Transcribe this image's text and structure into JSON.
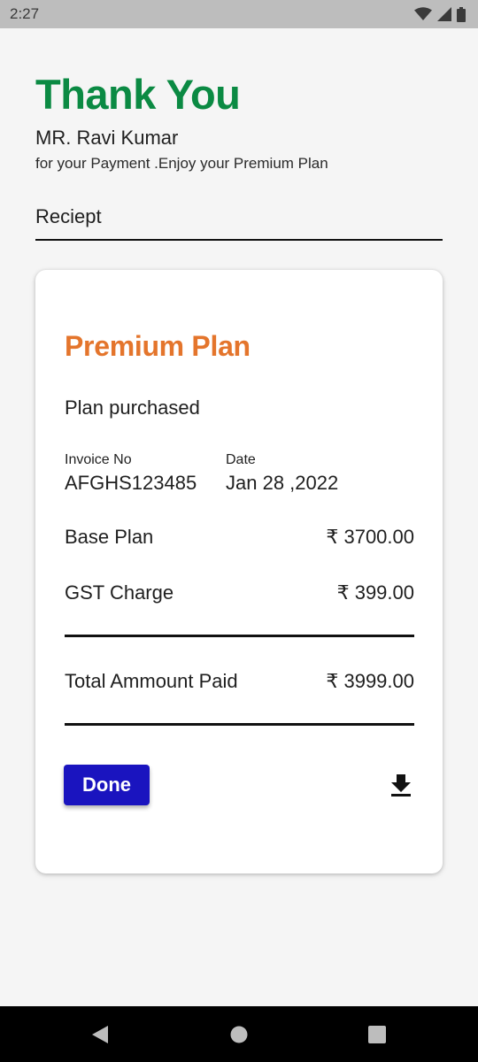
{
  "status_bar": {
    "time": "2:27",
    "icons": [
      "wifi-icon",
      "signal-icon",
      "battery-icon"
    ]
  },
  "header": {
    "title": "Thank You",
    "name": "MR. Ravi Kumar",
    "subtitle": "for your Payment .Enjoy your Premium Plan",
    "receipt_label": "Reciept"
  },
  "card": {
    "plan_title": "Premium Plan",
    "plan_sub": "Plan purchased",
    "invoice_label": "Invoice No",
    "invoice_value": "AFGHS123485",
    "date_label": "Date",
    "date_value": "Jan 28 ,2022",
    "rows": [
      {
        "label": "Base Plan",
        "value": "₹ 3700.00"
      },
      {
        "label": "GST Charge",
        "value": "₹ 399.00"
      }
    ],
    "total": {
      "label": "Total Ammount Paid",
      "value": "₹ 3999.00"
    },
    "done_label": "Done",
    "download_icon": "download-icon"
  },
  "nav_bar": {
    "icons": [
      "back-icon",
      "home-icon",
      "recents-icon"
    ]
  },
  "colors": {
    "title": "#0b8a43",
    "plan_title": "#e4752c",
    "done_button": "#1a14bf"
  }
}
